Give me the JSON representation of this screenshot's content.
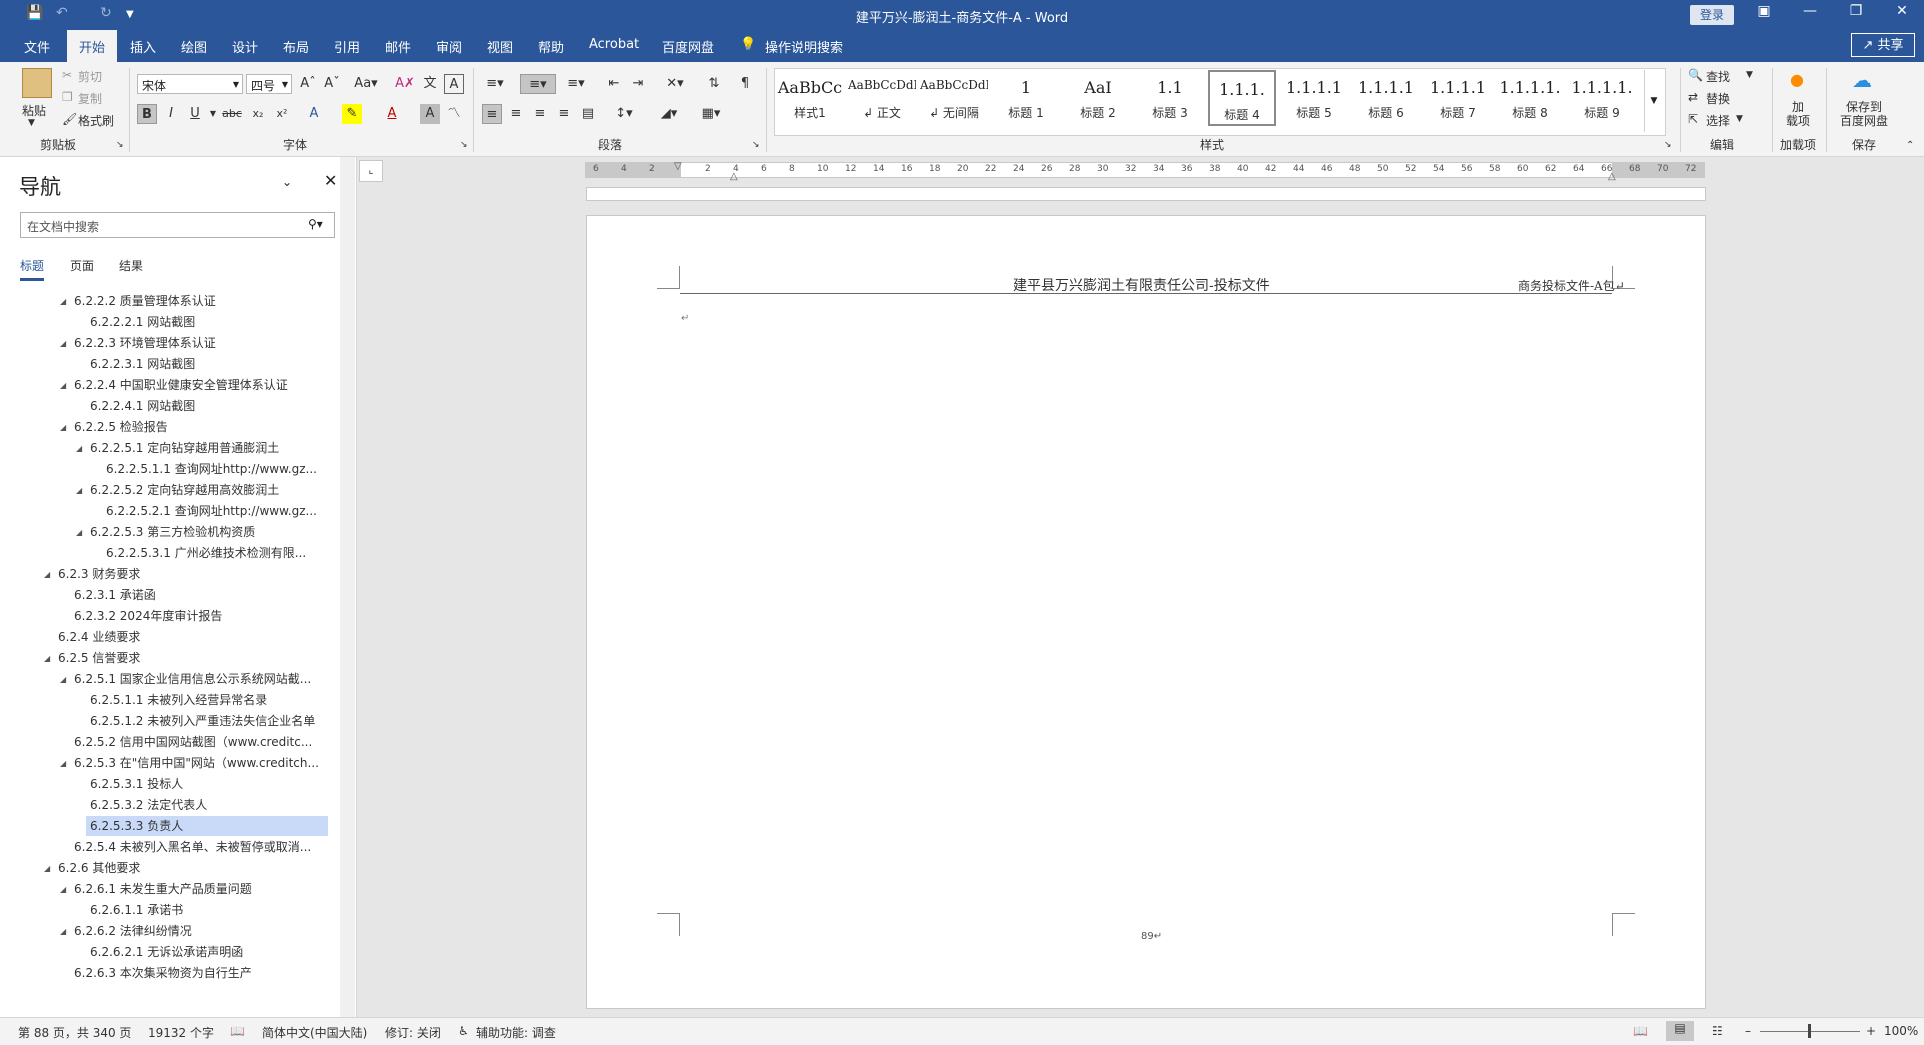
{
  "titlebar": {
    "title": "建平万兴-膨润土-商务文件-A - Word",
    "login": "登录",
    "save_icon": "save-icon"
  },
  "tabs": [
    "文件",
    "开始",
    "插入",
    "绘图",
    "设计",
    "布局",
    "引用",
    "邮件",
    "审阅",
    "视图",
    "帮助",
    "Acrobat",
    "百度网盘"
  ],
  "tell_me": "操作说明搜索",
  "share": "共享",
  "ribbon": {
    "clipboard": {
      "paste": "粘贴",
      "cut": "剪切",
      "copy": "复制",
      "format_painter": "格式刷",
      "label": "剪贴板"
    },
    "font": {
      "name": "宋体",
      "size": "四号",
      "label": "字体"
    },
    "paragraph": {
      "label": "段落"
    },
    "styles": {
      "label": "样式",
      "items": [
        {
          "preview": "AaBbCc",
          "name": "样式1"
        },
        {
          "preview": "AaBbCcDdI",
          "name": "↲ 正文"
        },
        {
          "preview": "AaBbCcDdI",
          "name": "↲ 无间隔"
        },
        {
          "preview": "1",
          "name": "标题 1"
        },
        {
          "preview": "AaI",
          "name": "标题 2"
        },
        {
          "preview": "1.1",
          "name": "标题 3"
        },
        {
          "preview": "1.1.1.",
          "name": "标题 4"
        },
        {
          "preview": "1.1.1.1",
          "name": "标题 5"
        },
        {
          "preview": "1.1.1.1",
          "name": "标题 6"
        },
        {
          "preview": "1.1.1.1",
          "name": "标题 7"
        },
        {
          "preview": "1.1.1.1.",
          "name": "标题 8"
        },
        {
          "preview": "1.1.1.1.",
          "name": "标题 9"
        }
      ]
    },
    "editing": {
      "find": "查找",
      "replace": "替换",
      "select": "选择",
      "label": "编辑"
    },
    "addins": {
      "label": "加载项",
      "btn": "加\n载项"
    },
    "save": {
      "btn": "保存到\n百度网盘",
      "label": "保存"
    }
  },
  "nav": {
    "title": "导航",
    "search_placeholder": "在文档中搜索",
    "tabs": [
      "标题",
      "页面",
      "结果"
    ],
    "items": [
      {
        "text": "6.2.2.2 质量管理体系认证",
        "level": 2,
        "tri": true
      },
      {
        "text": "6.2.2.2.1 网站截图",
        "level": 3,
        "tri": false
      },
      {
        "text": "6.2.2.3 环境管理体系认证",
        "level": 2,
        "tri": true
      },
      {
        "text": "6.2.2.3.1 网站截图",
        "level": 3,
        "tri": false
      },
      {
        "text": "6.2.2.4 中国职业健康安全管理体系认证",
        "level": 2,
        "tri": true
      },
      {
        "text": "6.2.2.4.1 网站截图",
        "level": 3,
        "tri": false
      },
      {
        "text": "6.2.2.5 检验报告",
        "level": 2,
        "tri": true
      },
      {
        "text": "6.2.2.5.1 定向钻穿越用普通膨润土",
        "level": 3,
        "tri": true
      },
      {
        "text": "6.2.2.5.1.1 查询网址http://www.gz...",
        "level": 4,
        "tri": false
      },
      {
        "text": "6.2.2.5.2 定向钻穿越用高效膨润土",
        "level": 3,
        "tri": true
      },
      {
        "text": "6.2.2.5.2.1 查询网址http://www.gz...",
        "level": 4,
        "tri": false
      },
      {
        "text": "6.2.2.5.3 第三方检验机构资质",
        "level": 3,
        "tri": true
      },
      {
        "text": "6.2.2.5.3.1 广州必维技术检测有限...",
        "level": 4,
        "tri": false
      },
      {
        "text": "6.2.3 财务要求",
        "level": 1,
        "tri": true
      },
      {
        "text": "6.2.3.1 承诺函",
        "level": 2,
        "tri": false
      },
      {
        "text": "6.2.3.2 2024年度审计报告",
        "level": 2,
        "tri": false
      },
      {
        "text": "6.2.4 业绩要求",
        "level": 1,
        "tri": false
      },
      {
        "text": "6.2.5 信誉要求",
        "level": 1,
        "tri": true
      },
      {
        "text": "6.2.5.1 国家企业信用信息公示系统网站截...",
        "level": 2,
        "tri": true
      },
      {
        "text": "6.2.5.1.1 未被列入经营异常名录",
        "level": 3,
        "tri": false
      },
      {
        "text": "6.2.5.1.2 未被列入严重违法失信企业名单",
        "level": 3,
        "tri": false
      },
      {
        "text": "6.2.5.2 信用中国网站截图（www.creditc...",
        "level": 2,
        "tri": false
      },
      {
        "text": "6.2.5.3 在\"信用中国\"网站（www.creditch...",
        "level": 2,
        "tri": true
      },
      {
        "text": "6.2.5.3.1 投标人",
        "level": 3,
        "tri": false
      },
      {
        "text": "6.2.5.3.2 法定代表人",
        "level": 3,
        "tri": false
      },
      {
        "text": "6.2.5.3.3 负责人",
        "level": 3,
        "tri": false,
        "selected": true
      },
      {
        "text": "6.2.5.4 未被列入黑名单、未被暂停或取消...",
        "level": 2,
        "tri": false
      },
      {
        "text": "6.2.6 其他要求",
        "level": 1,
        "tri": true
      },
      {
        "text": "6.2.6.1 未发生重大产品质量问题",
        "level": 2,
        "tri": true
      },
      {
        "text": "6.2.6.1.1 承诺书",
        "level": 3,
        "tri": false
      },
      {
        "text": "6.2.6.2 法律纠纷情况",
        "level": 2,
        "tri": true
      },
      {
        "text": "6.2.6.2.1 无诉讼承诺声明函",
        "level": 3,
        "tri": false
      },
      {
        "text": "6.2.6.3 本次集采物资为自行生产",
        "level": 2,
        "tri": false
      }
    ]
  },
  "ruler_numbers": [
    "6",
    "4",
    "2",
    "",
    "2",
    "4",
    "6",
    "8",
    "10",
    "12",
    "14",
    "16",
    "18",
    "20",
    "22",
    "24",
    "26",
    "28",
    "30",
    "32",
    "34",
    "36",
    "38",
    "40",
    "42",
    "44",
    "46",
    "48",
    "50",
    "52",
    "54",
    "56",
    "58",
    "60",
    "62",
    "64",
    "66",
    "68",
    "70",
    "72"
  ],
  "document": {
    "header_center": "建平县万兴膨润土有限责任公司-投标文件",
    "header_right": "商务投标文件-A包↵",
    "para_mark": "↵",
    "page_number": "89↵"
  },
  "status": {
    "page": "第 88 页，共 340 页",
    "words": "19132 个字",
    "language": "简体中文(中国大陆)",
    "track": "修订: 关闭",
    "accessibility": "辅助功能: 调查",
    "zoom": "100%"
  }
}
